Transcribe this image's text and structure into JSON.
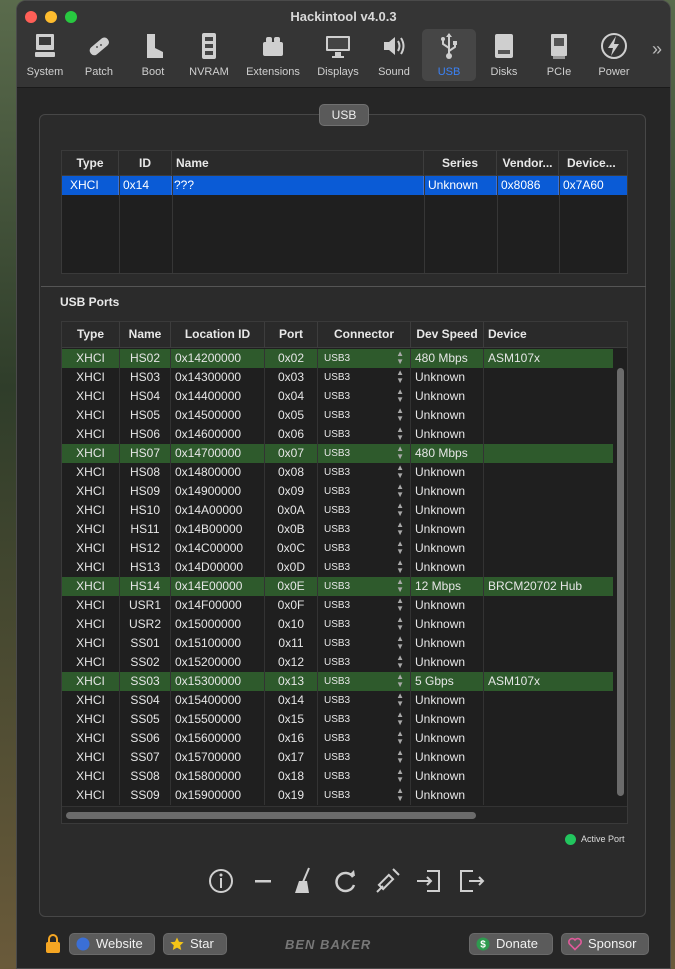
{
  "window": {
    "title": "Hackintool v4.0.3"
  },
  "toolbar": {
    "items": [
      {
        "label": "System",
        "icon": "computer-icon"
      },
      {
        "label": "Patch",
        "icon": "bandage-icon"
      },
      {
        "label": "Boot",
        "icon": "boot-icon"
      },
      {
        "label": "NVRAM",
        "icon": "memory-chip-icon"
      },
      {
        "label": "Extensions",
        "icon": "lego-brick-icon"
      },
      {
        "label": "Displays",
        "icon": "display-icon"
      },
      {
        "label": "Sound",
        "icon": "speaker-icon"
      },
      {
        "label": "USB",
        "icon": "usb-icon"
      },
      {
        "label": "Disks",
        "icon": "disk-icon"
      },
      {
        "label": "PCIe",
        "icon": "pcie-card-icon"
      },
      {
        "label": "Power",
        "icon": "lightning-bolt-icon"
      }
    ],
    "active": "USB",
    "overflow": "»",
    "active_color": "#3b82f6"
  },
  "panel": {
    "tag": "USB"
  },
  "controllers": {
    "headers": [
      "Type",
      "ID",
      "Name",
      "Series",
      "Vendor...",
      "Device..."
    ],
    "rows": [
      [
        "XHCI",
        "0x14",
        "???",
        "Unknown",
        "0x8086",
        "0x7A60"
      ]
    ],
    "selected_color": "#0a5bd6"
  },
  "ports": {
    "title": "USB Ports",
    "headers": [
      "Type",
      "Name",
      "Location ID",
      "Port",
      "Connector",
      "Dev Speed",
      "Device"
    ],
    "rows": [
      {
        "type": "XHCI",
        "name": "HS02",
        "location": "0x14200000",
        "port": "0x02",
        "connector": "USB3",
        "speed": "480 Mbps",
        "device": "ASM107x",
        "active": true
      },
      {
        "type": "XHCI",
        "name": "HS03",
        "location": "0x14300000",
        "port": "0x03",
        "connector": "USB3",
        "speed": "Unknown",
        "device": "",
        "active": false
      },
      {
        "type": "XHCI",
        "name": "HS04",
        "location": "0x14400000",
        "port": "0x04",
        "connector": "USB3",
        "speed": "Unknown",
        "device": "",
        "active": false
      },
      {
        "type": "XHCI",
        "name": "HS05",
        "location": "0x14500000",
        "port": "0x05",
        "connector": "USB3",
        "speed": "Unknown",
        "device": "",
        "active": false
      },
      {
        "type": "XHCI",
        "name": "HS06",
        "location": "0x14600000",
        "port": "0x06",
        "connector": "USB3",
        "speed": "Unknown",
        "device": "",
        "active": false
      },
      {
        "type": "XHCI",
        "name": "HS07",
        "location": "0x14700000",
        "port": "0x07",
        "connector": "USB3",
        "speed": "480 Mbps",
        "device": "",
        "active": true
      },
      {
        "type": "XHCI",
        "name": "HS08",
        "location": "0x14800000",
        "port": "0x08",
        "connector": "USB3",
        "speed": "Unknown",
        "device": "",
        "active": false
      },
      {
        "type": "XHCI",
        "name": "HS09",
        "location": "0x14900000",
        "port": "0x09",
        "connector": "USB3",
        "speed": "Unknown",
        "device": "",
        "active": false
      },
      {
        "type": "XHCI",
        "name": "HS10",
        "location": "0x14A00000",
        "port": "0x0A",
        "connector": "USB3",
        "speed": "Unknown",
        "device": "",
        "active": false
      },
      {
        "type": "XHCI",
        "name": "HS11",
        "location": "0x14B00000",
        "port": "0x0B",
        "connector": "USB3",
        "speed": "Unknown",
        "device": "",
        "active": false
      },
      {
        "type": "XHCI",
        "name": "HS12",
        "location": "0x14C00000",
        "port": "0x0C",
        "connector": "USB3",
        "speed": "Unknown",
        "device": "",
        "active": false
      },
      {
        "type": "XHCI",
        "name": "HS13",
        "location": "0x14D00000",
        "port": "0x0D",
        "connector": "USB3",
        "speed": "Unknown",
        "device": "",
        "active": false
      },
      {
        "type": "XHCI",
        "name": "HS14",
        "location": "0x14E00000",
        "port": "0x0E",
        "connector": "USB3",
        "speed": "12 Mbps",
        "device": "BRCM20702 Hub",
        "active": true
      },
      {
        "type": "XHCI",
        "name": "USR1",
        "location": "0x14F00000",
        "port": "0x0F",
        "connector": "USB3",
        "speed": "Unknown",
        "device": "",
        "active": false
      },
      {
        "type": "XHCI",
        "name": "USR2",
        "location": "0x15000000",
        "port": "0x10",
        "connector": "USB3",
        "speed": "Unknown",
        "device": "",
        "active": false
      },
      {
        "type": "XHCI",
        "name": "SS01",
        "location": "0x15100000",
        "port": "0x11",
        "connector": "USB3",
        "speed": "Unknown",
        "device": "",
        "active": false
      },
      {
        "type": "XHCI",
        "name": "SS02",
        "location": "0x15200000",
        "port": "0x12",
        "connector": "USB3",
        "speed": "Unknown",
        "device": "",
        "active": false
      },
      {
        "type": "XHCI",
        "name": "SS03",
        "location": "0x15300000",
        "port": "0x13",
        "connector": "USB3",
        "speed": "5 Gbps",
        "device": "ASM107x",
        "active": true
      },
      {
        "type": "XHCI",
        "name": "SS04",
        "location": "0x15400000",
        "port": "0x14",
        "connector": "USB3",
        "speed": "Unknown",
        "device": "",
        "active": false
      },
      {
        "type": "XHCI",
        "name": "SS05",
        "location": "0x15500000",
        "port": "0x15",
        "connector": "USB3",
        "speed": "Unknown",
        "device": "",
        "active": false
      },
      {
        "type": "XHCI",
        "name": "SS06",
        "location": "0x15600000",
        "port": "0x16",
        "connector": "USB3",
        "speed": "Unknown",
        "device": "",
        "active": false
      },
      {
        "type": "XHCI",
        "name": "SS07",
        "location": "0x15700000",
        "port": "0x17",
        "connector": "USB3",
        "speed": "Unknown",
        "device": "",
        "active": false
      },
      {
        "type": "XHCI",
        "name": "SS08",
        "location": "0x15800000",
        "port": "0x18",
        "connector": "USB3",
        "speed": "Unknown",
        "device": "",
        "active": false
      },
      {
        "type": "XHCI",
        "name": "SS09",
        "location": "0x15900000",
        "port": "0x19",
        "connector": "USB3",
        "speed": "Unknown",
        "device": "",
        "active": false
      }
    ],
    "active_row_color": "#2e5a2c"
  },
  "legend": {
    "label": "Active Port",
    "color": "#22c55e"
  },
  "actions": [
    {
      "name": "info-icon"
    },
    {
      "name": "minus-icon"
    },
    {
      "name": "broom-icon"
    },
    {
      "name": "refresh-icon"
    },
    {
      "name": "syringe-icon"
    },
    {
      "name": "import-icon"
    },
    {
      "name": "export-icon"
    }
  ],
  "footer": {
    "website": "Website",
    "star": "Star",
    "brand": "BEN BAKER",
    "donate": "Donate",
    "sponsor": "Sponsor"
  }
}
